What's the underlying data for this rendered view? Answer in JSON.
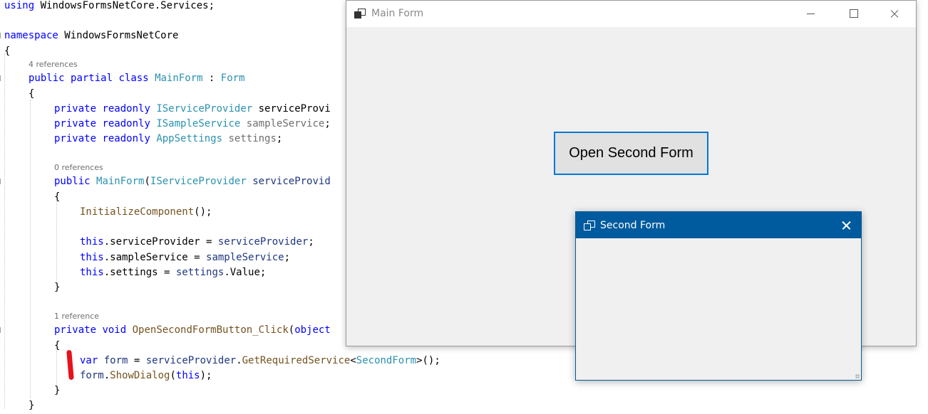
{
  "code_editor": {
    "line_using": [
      "using",
      " WindowsFormsNetCore.Services;"
    ],
    "line_namespace": [
      "namespace",
      " WindowsFormsNetCore"
    ],
    "brace_open_1": "{",
    "codelens_class": "4 references",
    "line_class": [
      "public",
      " ",
      "partial",
      " ",
      "class",
      " ",
      "MainForm",
      " : ",
      "Form"
    ],
    "brace_open_2": "{",
    "field_1": [
      "private",
      " ",
      "readonly",
      " ",
      "IServiceProvider",
      " serviceProvi"
    ],
    "field_2": [
      "private",
      " ",
      "readonly",
      " ",
      "ISampleService",
      " ",
      "sampleService",
      ";"
    ],
    "field_3": [
      "private",
      " ",
      "readonly",
      " ",
      "AppSettings",
      " ",
      "settings",
      ";"
    ],
    "codelens_ctor": "0 references",
    "line_ctor": [
      "public",
      " ",
      "MainForm",
      "(",
      "IServiceProvider",
      " ",
      "serviceProvid"
    ],
    "brace_open_3": "{",
    "init_call": [
      "InitializeComponent",
      "();"
    ],
    "assign_1": [
      "this",
      ".serviceProvider = ",
      "serviceProvider",
      ";"
    ],
    "assign_2": [
      "this",
      ".sampleService = ",
      "sampleService",
      ";"
    ],
    "assign_3": [
      "this",
      ".settings = ",
      "settings",
      ".Value;"
    ],
    "brace_close_3": "}",
    "codelens_method": "1 reference",
    "line_method": [
      "private",
      " ",
      "void",
      " ",
      "OpenSecondFormButton_Click",
      "(",
      "object"
    ],
    "brace_open_4": "{",
    "var_line": [
      "var",
      " ",
      "form",
      " = ",
      "serviceProvider",
      ".",
      "GetRequiredService",
      "<",
      "SecondForm",
      ">();"
    ],
    "show_line": [
      "form",
      ".",
      "ShowDialog",
      "(",
      "this",
      ");"
    ],
    "brace_close_4": "}",
    "brace_close_2": "}"
  },
  "main_form": {
    "title": "Main Form",
    "button_label": "Open Second Form"
  },
  "second_form": {
    "title": "Second Form"
  },
  "colors": {
    "keyword": "#0000ff",
    "type": "#2b91af",
    "method": "#74531f",
    "variable": "#1f377f",
    "accent": "#0078d7",
    "dialog_titlebar": "#005a9e",
    "annotation_mark": "#e8101a"
  },
  "icons": [
    "form-window-icon",
    "minimize-icon",
    "maximize-icon",
    "close-icon",
    "resize-grip-icon"
  ]
}
